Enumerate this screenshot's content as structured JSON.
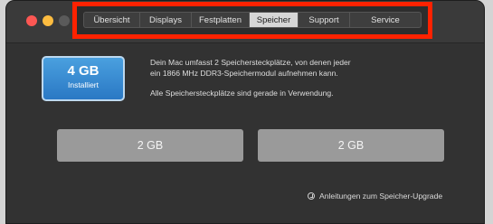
{
  "window": {
    "tabs": [
      {
        "label": "Übersicht",
        "active": false
      },
      {
        "label": "Displays",
        "active": false
      },
      {
        "label": "Festplatten",
        "active": false
      },
      {
        "label": "Speicher",
        "active": true
      },
      {
        "label": "Support",
        "active": false
      },
      {
        "label": "Service",
        "active": false
      }
    ]
  },
  "memory": {
    "size": "4 GB",
    "status": "Installiert",
    "description_line1": "Dein Mac umfasst 2 Speichersteckplätze, von denen jeder",
    "description_line2": "ein 1866 MHz DDR3-Speichermodul aufnehmen kann.",
    "slots_note": "Alle Speichersteckplätze sind gerade in Verwendung.",
    "slots": [
      "2 GB",
      "2 GB"
    ],
    "upgrade_link": "Anleitungen zum Speicher-Upgrade"
  },
  "colors": {
    "highlight": "#ff2200",
    "badge_accent": "#2f83cf"
  }
}
